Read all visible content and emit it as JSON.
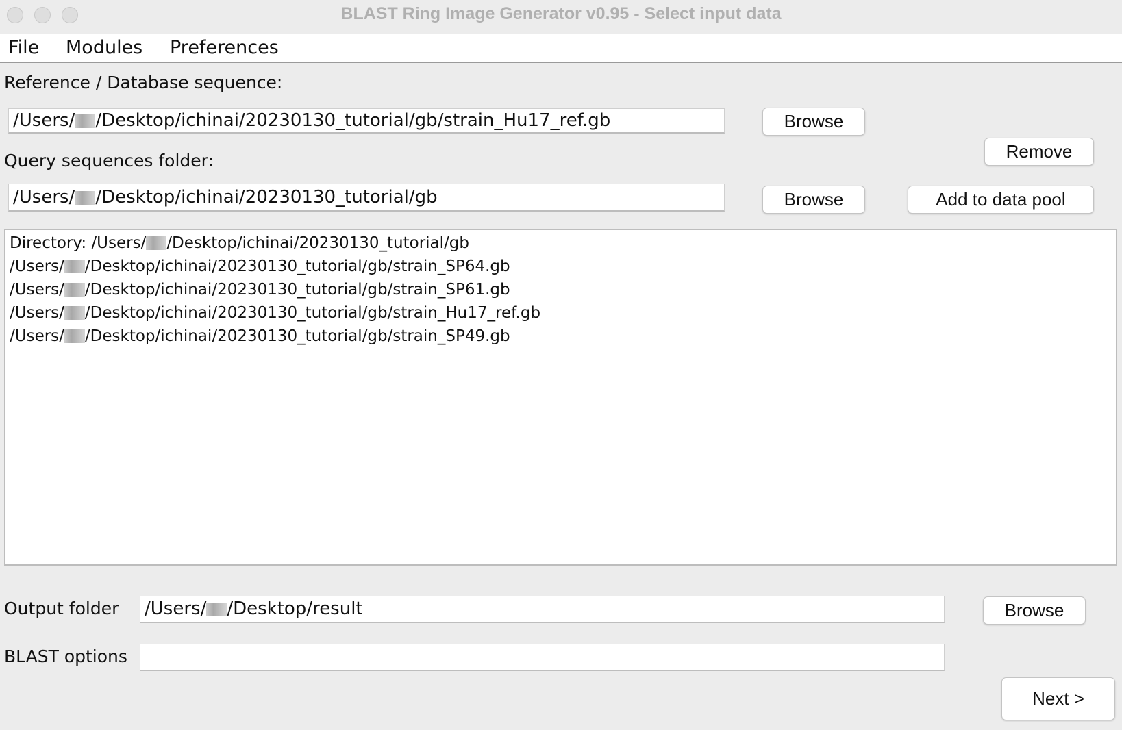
{
  "window": {
    "title": "BLAST Ring Image Generator v0.95 - Select input data"
  },
  "menubar": {
    "items": [
      "File",
      "Modules",
      "Preferences"
    ]
  },
  "reference": {
    "label": "Reference / Database sequence:",
    "path_prefix": "/Users/",
    "path_suffix": "/Desktop/ichinai/20230130_tutorial/gb/strain_Hu17_ref.gb",
    "browse_label": "Browse"
  },
  "remove_label": "Remove",
  "query": {
    "label": "Query sequences folder:",
    "path_prefix": "/Users/",
    "path_suffix": "/Desktop/ichinai/20230130_tutorial/gb",
    "browse_label": "Browse",
    "add_label": "Add to data pool"
  },
  "data_pool": {
    "lines": [
      {
        "prefix": "Directory:  /Users/",
        "suffix": "/Desktop/ichinai/20230130_tutorial/gb"
      },
      {
        "prefix": "/Users/",
        "suffix": "/Desktop/ichinai/20230130_tutorial/gb/strain_SP64.gb"
      },
      {
        "prefix": "/Users/",
        "suffix": "/Desktop/ichinai/20230130_tutorial/gb/strain_SP61.gb"
      },
      {
        "prefix": "/Users/",
        "suffix": "/Desktop/ichinai/20230130_tutorial/gb/strain_Hu17_ref.gb"
      },
      {
        "prefix": "/Users/",
        "suffix": "/Desktop/ichinai/20230130_tutorial/gb/strain_SP49.gb"
      }
    ]
  },
  "output": {
    "label": "Output folder",
    "path_prefix": "/Users/",
    "path_suffix": "/Desktop/result",
    "browse_label": "Browse"
  },
  "blast_options": {
    "label": "BLAST options",
    "value": ""
  },
  "next_label": "Next >",
  "colors": {
    "window_bg": "#ececec",
    "title_text": "#b0b0b0",
    "field_bg": "#ffffff"
  }
}
